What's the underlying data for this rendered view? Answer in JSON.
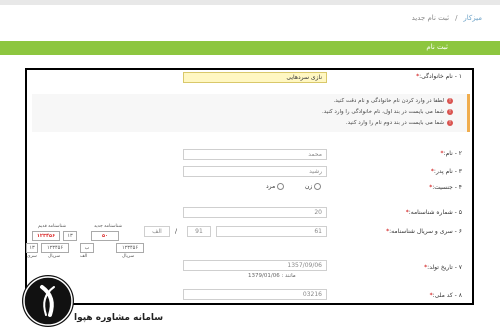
{
  "breadcrumb": {
    "home": "میزکار",
    "current": "ثبت نام جدید"
  },
  "section_title": "ثبت نام",
  "form": {
    "family_label": "۱ - نام خانوادگی:",
    "family_value": "نازی سردهایی",
    "alerts": [
      "لطفا در وارد کردن نام خانوادگی و نام دقت کنید.",
      "شما می بایست در بند اول، نام خانوادگی را وارد کنید.",
      "شما می بایست در بند دوم نام را وارد کنید."
    ],
    "name_label": "۲ - نام:",
    "name_value": "محمد",
    "father_label": "۳ - نام پدر:",
    "father_value": "رشید",
    "gender_label": "۴ - جنسیت:",
    "gender_female": "زن",
    "gender_male": "مرد",
    "idnum_label": "۵ - شماره شناسنامه:",
    "idnum_value": "20",
    "serial_label": "۶ - سری و سریال شناسنامه:",
    "serial_value": "61",
    "serial_part2": "91",
    "serial_part3": "الف",
    "birth_label": "۷ - تاریخ تولد:",
    "birth_value": "1357/09/06",
    "birth_hint": "مانند : 1379/01/06",
    "national_label": "۸ - کد ملی:",
    "national_value": "03216"
  },
  "sample": {
    "old_label": "شناسنامه قدیم",
    "new_label": "شناسنامه جدید",
    "red_number": "۱۲۳۴۵۶",
    "small_code": "۱۳",
    "series_text": "سری",
    "serial_text": "سریال",
    "letter_code": "الف",
    "middle_number": "۱۲۳۴۵۶",
    "right_number": "۱۲۳۴۵۶",
    "right_small": "۵۰",
    "new_small": "ب"
  },
  "logo": {
    "text": "سامانه مشاوره هپوا"
  }
}
